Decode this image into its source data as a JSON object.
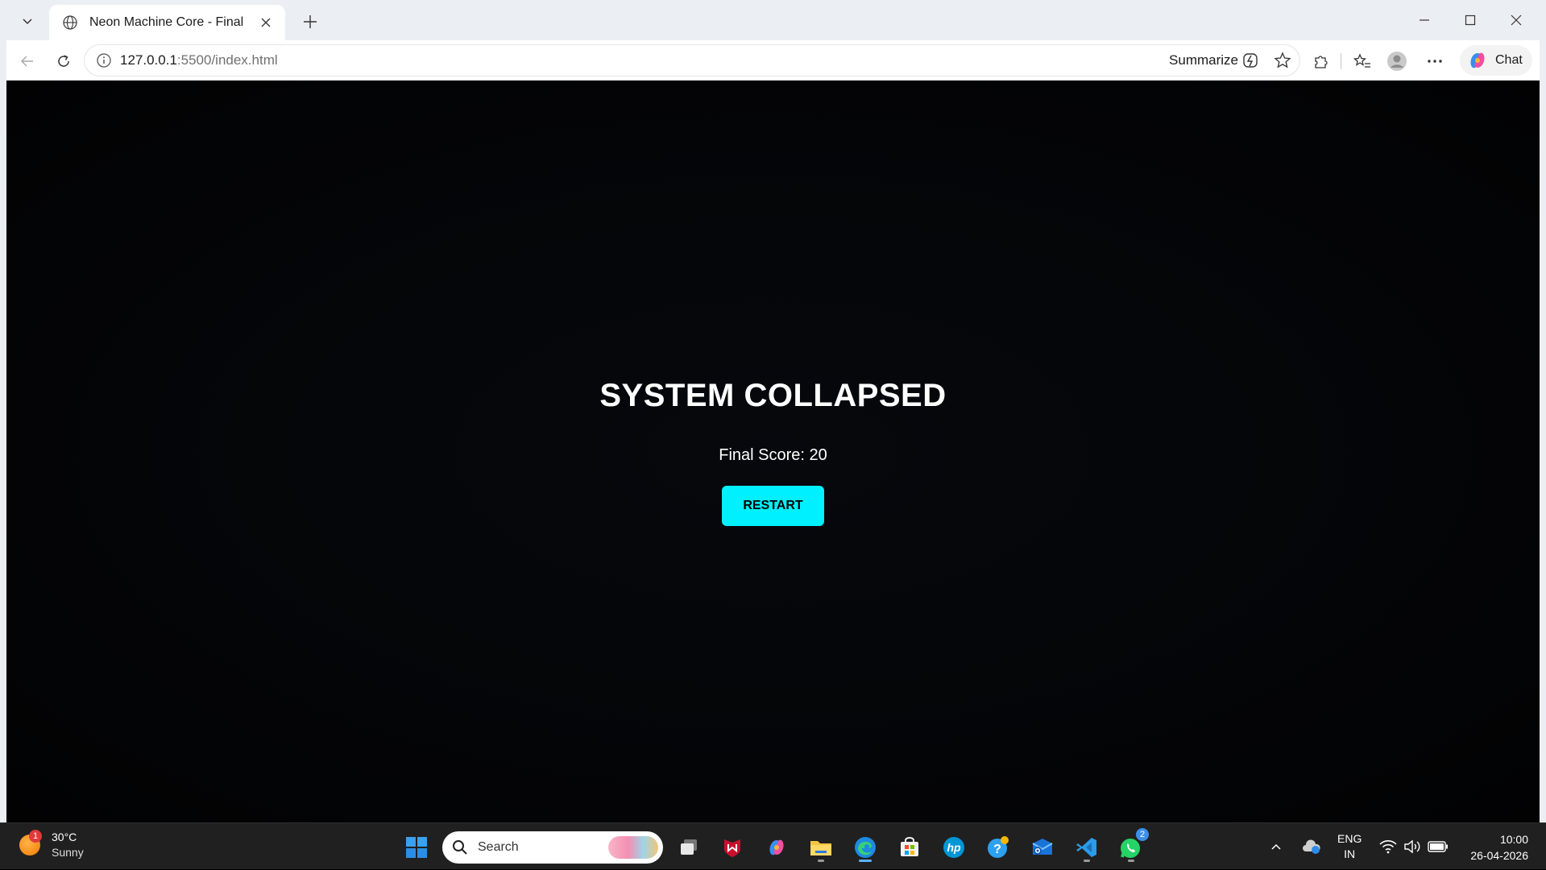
{
  "browser": {
    "tab_title": "Neon Machine Core - Final",
    "url_host": "127.0.0.1",
    "url_path": ":5500/index.html",
    "summarize_label": "Summarize",
    "chat_label": "Chat"
  },
  "game": {
    "title": "SYSTEM COLLAPSED",
    "score_text": "Final Score: 20",
    "restart_label": "RESTART",
    "accent_color": "#00f0ff"
  },
  "taskbar": {
    "weather_badge": "1",
    "temperature": "30°C",
    "condition": "Sunny",
    "search_placeholder": "Search",
    "whatsapp_badge": "2",
    "lang_top": "ENG",
    "lang_bottom": "IN",
    "time": "10:00",
    "date": "26-04-2026",
    "apps": [
      "start-icon",
      "search-icon",
      "task-view-icon",
      "mcafee-icon",
      "copilot-icon",
      "file-explorer-icon",
      "edge-icon",
      "store-icon",
      "hp-icon",
      "help-icon",
      "outlook-icon",
      "vscode-icon",
      "whatsapp-icon"
    ]
  }
}
